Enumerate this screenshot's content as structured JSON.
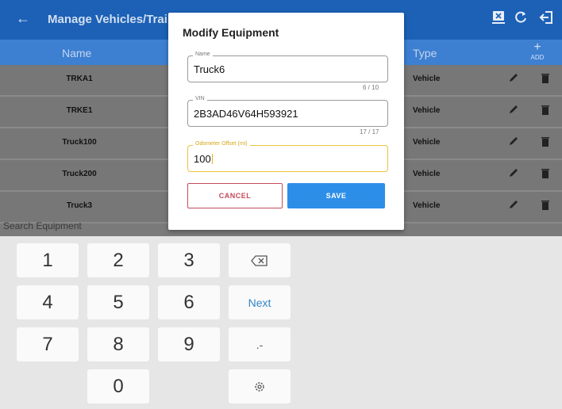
{
  "appbar": {
    "title": "Manage Vehicles/Trailer",
    "back_icon": "arrow-left-icon",
    "icons": [
      "equipment-remove-icon",
      "refresh-icon",
      "logout-icon"
    ]
  },
  "table": {
    "col_name": "Name",
    "col_type": "Type",
    "add_label": "ADD",
    "add_icon": "+",
    "rows": [
      {
        "name": "TRKA1",
        "type": "Vehicle"
      },
      {
        "name": "TRKE1",
        "type": "Vehicle"
      },
      {
        "name": "Truck100",
        "type": "Vehicle"
      },
      {
        "name": "Truck200",
        "type": "Vehicle"
      },
      {
        "name": "Truck3",
        "type": "Vehicle"
      }
    ]
  },
  "search": {
    "placeholder": "Search Equipment"
  },
  "dialog": {
    "title": "Modify Equipment",
    "name": {
      "label": "Name",
      "value": "Truck6",
      "counter": "6 / 10"
    },
    "vin": {
      "label": "VIN",
      "value": "2B3AD46V64H593921",
      "counter": "17 / 17"
    },
    "odometer": {
      "label": "Odometer Offset (mi)",
      "value": "100"
    },
    "cancel_label": "CANCEL",
    "save_label": "SAVE"
  },
  "keyboard": {
    "k1": "1",
    "k2": "2",
    "k3": "3",
    "k4": "4",
    "k5": "5",
    "k6": "6",
    "k7": "7",
    "k8": "8",
    "k9": "9",
    "k0": "0",
    "next": "Next",
    "punct": ".-",
    "backspace_icon": "backspace-icon",
    "settings_icon": "gear-icon"
  },
  "colors": {
    "appbar": "#1c61b6",
    "header": "#3d7fd1",
    "save": "#2d8ee8",
    "cancel": "#c44b5c",
    "focus": "#e9c43a"
  }
}
